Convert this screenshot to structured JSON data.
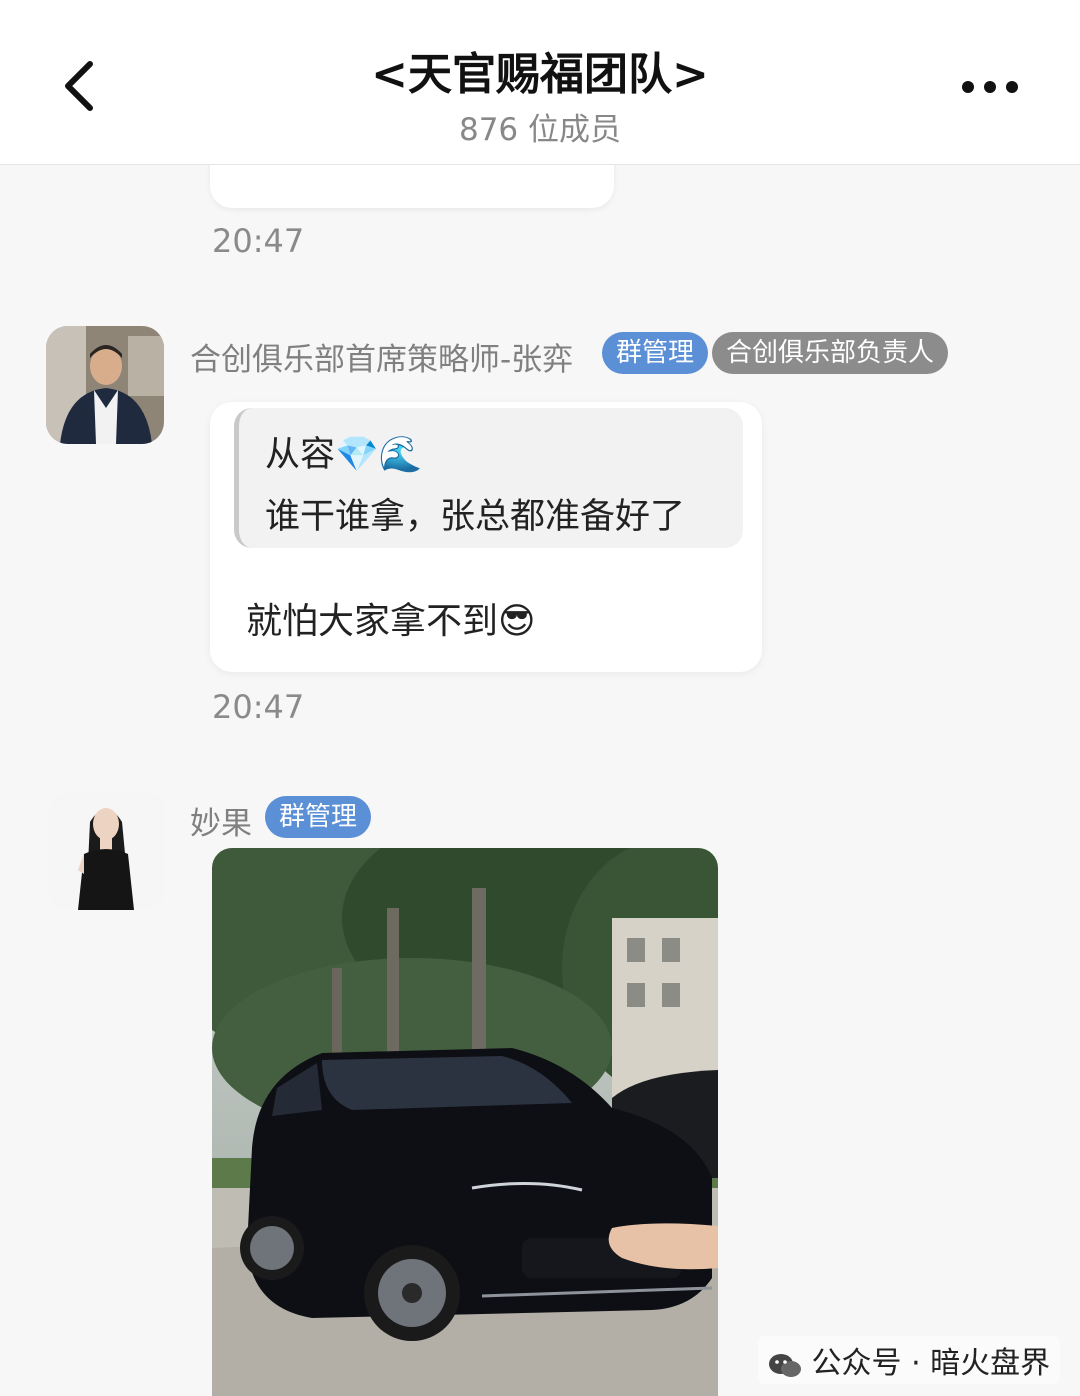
{
  "header": {
    "title": "<天官赐福团队>",
    "member_count": "876 位成员"
  },
  "messages": [
    {
      "time": "20:47"
    },
    {
      "sender": "合创俱乐部首席策略师-张弈",
      "badges": [
        "群管理",
        "合创俱乐部负责人"
      ],
      "quote": {
        "name": "从容💎🌊",
        "text": "谁干谁拿，张总都准备好了"
      },
      "text": "就怕大家拿不到😎",
      "time": "20:47"
    },
    {
      "sender": "妙果",
      "badges": [
        "群管理"
      ],
      "image": "black-suv-photo"
    }
  ],
  "watermark": "公众号 · 暗火盘界",
  "colors": {
    "badge_admin": "#5b8fd6",
    "badge_role": "#8c8c8c",
    "background": "#f7f7f7"
  },
  "icons": [
    "back-icon",
    "more-icon",
    "wechat-icon"
  ]
}
